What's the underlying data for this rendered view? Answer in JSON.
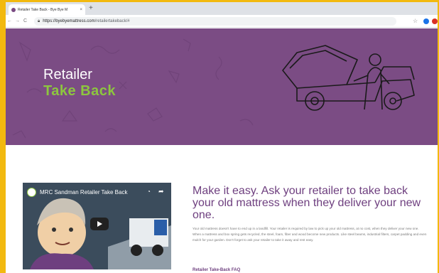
{
  "browser": {
    "tab_title": "Retailer Take Back - Bye Bye M",
    "tab_close": "×",
    "new_tab": "+",
    "back": "←",
    "forward": "→",
    "reload": "C",
    "url_host": "https://byebyemattress.com",
    "url_path": "/retailertakeback/#",
    "bookmark_star": "☆"
  },
  "hero": {
    "title": "Retailer",
    "subtitle": "Take Back"
  },
  "video": {
    "title": "MRC Sandman Retailer Take Back"
  },
  "content": {
    "headline": "Make it easy. Ask your retailer to take back your old mattress when they deliver your new one.",
    "body": "Your old mattress doesn't have to end up in a landfill. Your retailer is required by law to pick up your old mattress, at no cost, when they deliver your new one. When a mattress and box spring gets recycled, the steel, foam, fiber and wood become new products. Like steel beams, industrial filters, carpet padding and even mulch for your garden. Don't forget to ask your retailer to take it away and rest easy.",
    "faq_link": "Retailer Take-Back FAQ"
  },
  "colors": {
    "frame": "#f2b90f",
    "hero_bg": "#7b4c84",
    "accent_green": "#8dc63f",
    "headline_purple": "#6e3f7f"
  }
}
